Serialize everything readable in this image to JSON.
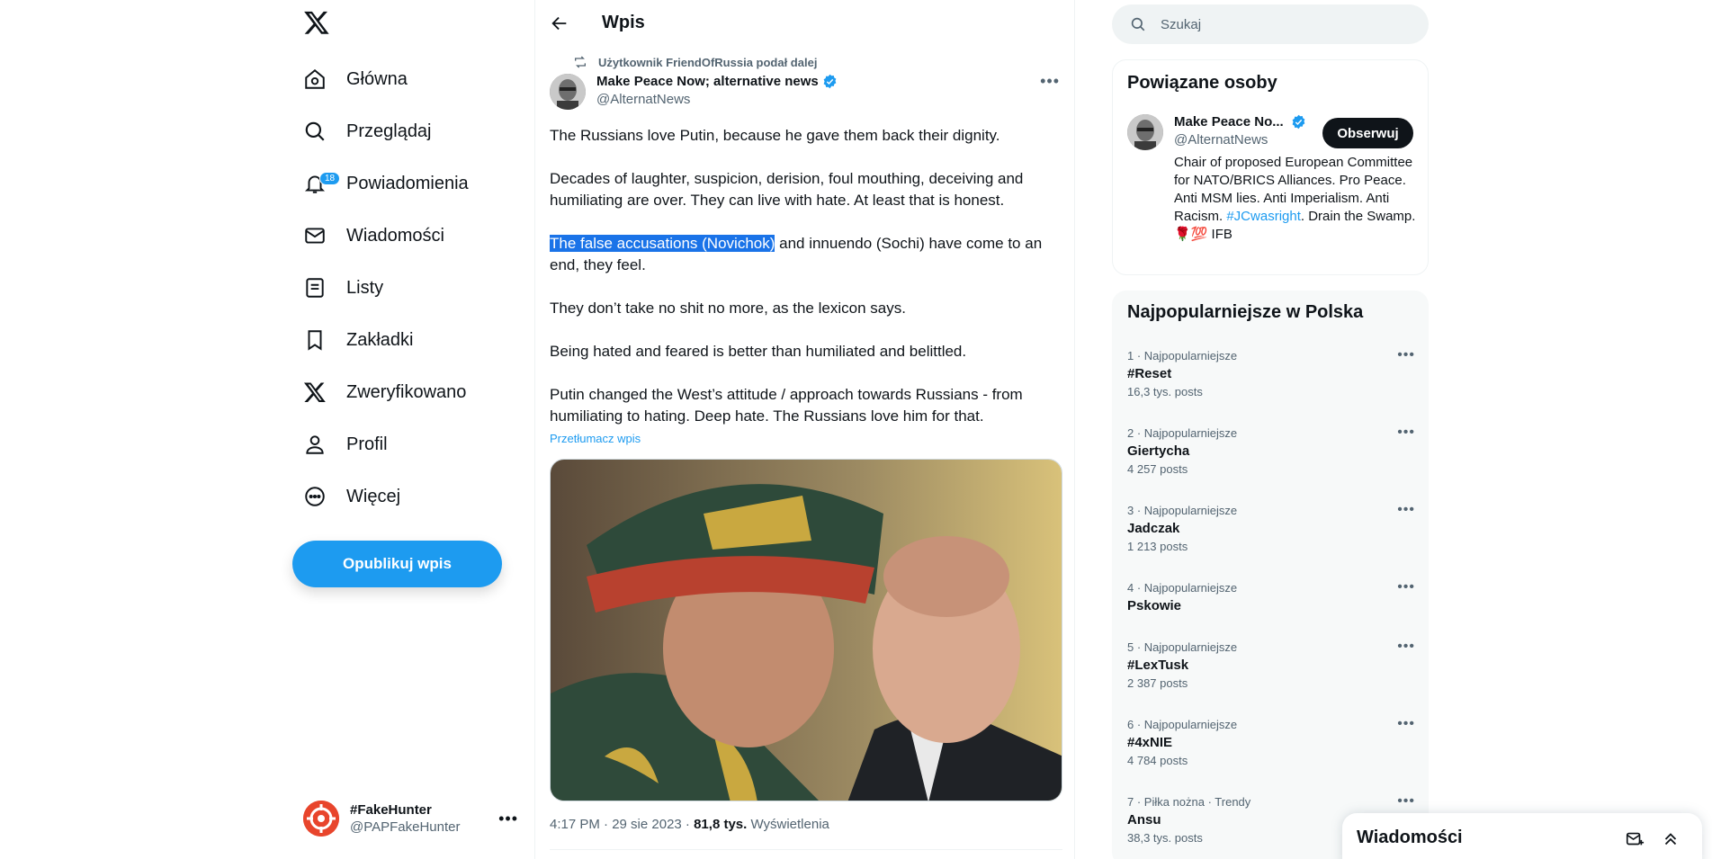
{
  "nav": {
    "items": [
      {
        "label": "Główna"
      },
      {
        "label": "Przeglądaj"
      },
      {
        "label": "Powiadomienia",
        "badge": "18"
      },
      {
        "label": "Wiadomości"
      },
      {
        "label": "Listy"
      },
      {
        "label": "Zakładki"
      },
      {
        "label": "Zweryfikowano"
      },
      {
        "label": "Profil"
      },
      {
        "label": "Więcej"
      }
    ],
    "post_button": "Opublikuj wpis",
    "account": {
      "name": "#FakeHunter",
      "handle": "@PAPFakeHunter"
    }
  },
  "main": {
    "title": "Wpis",
    "repost_text": "Użytkownik FriendOfRussia podał dalej",
    "author": {
      "name": "Make Peace Now; alternative news",
      "handle": "@AlternatNews"
    },
    "paragraphs": {
      "p1": "The Russians love Putin, because he gave them back their dignity.",
      "p2": "Decades of laughter, suspicion, derision, foul mouthing, deceiving and humiliating are over. They can live with hate. At least that is honest.",
      "p3_highlight": "The false accusations (Novichok)",
      "p3_rest": " and innuendo (Sochi) have come to an end, they feel.",
      "p4": "They don’t take no shit no more, as the lexicon says.",
      "p5": "Being hated and feared is better than humiliated and belittled.",
      "p6": "Putin changed the West’s attitude / approach towards Russians - from humiliating to hating. Deep hate. The Russians love him for that."
    },
    "translate_label": "Przetłumacz wpis",
    "meta": {
      "time": "4:17 PM · 29 sie 2023 · ",
      "views": "81,8 tys.",
      "views_label": " Wyświetlenia"
    }
  },
  "search": {
    "placeholder": "Szukaj"
  },
  "related": {
    "title": "Powiązane osoby",
    "name": "Make Peace No...",
    "handle": "@AlternatNews",
    "follow_label": "Obserwuj",
    "bio_1": "Chair of proposed European Committee for NATO/BRICS Alliances. Pro Peace. Anti MSM lies. Anti Imperialism. Anti Racism. ",
    "bio_tag": "#JCwasright",
    "bio_2": ". Drain the Swamp. 🌹💯 IFB"
  },
  "trends": {
    "title": "Najpopularniejsze w Polska",
    "items": [
      {
        "meta": "1 · Najpopularniejsze",
        "name": "#Reset",
        "count": "16,3 tys. posts"
      },
      {
        "meta": "2 · Najpopularniejsze",
        "name": "Giertycha",
        "count": "4 257 posts"
      },
      {
        "meta": "3 · Najpopularniejsze",
        "name": "Jadczak",
        "count": "1 213 posts"
      },
      {
        "meta": "4 · Najpopularniejsze",
        "name": "Pskowie",
        "count": ""
      },
      {
        "meta": "5 · Najpopularniejsze",
        "name": "#LexTusk",
        "count": "2 387 posts"
      },
      {
        "meta": "6 · Najpopularniejsze",
        "name": "#4xNIE",
        "count": "4 784 posts"
      },
      {
        "meta": "7 · Piłka nożna · Trendy",
        "name": "Ansu",
        "count": "38,3 tys. posts"
      }
    ]
  },
  "messages": {
    "title": "Wiadomości"
  },
  "colors": {
    "accent": "#1d9bf0",
    "text": "#0f1419",
    "secondary": "#536471",
    "highlight": "#1a73e8"
  }
}
